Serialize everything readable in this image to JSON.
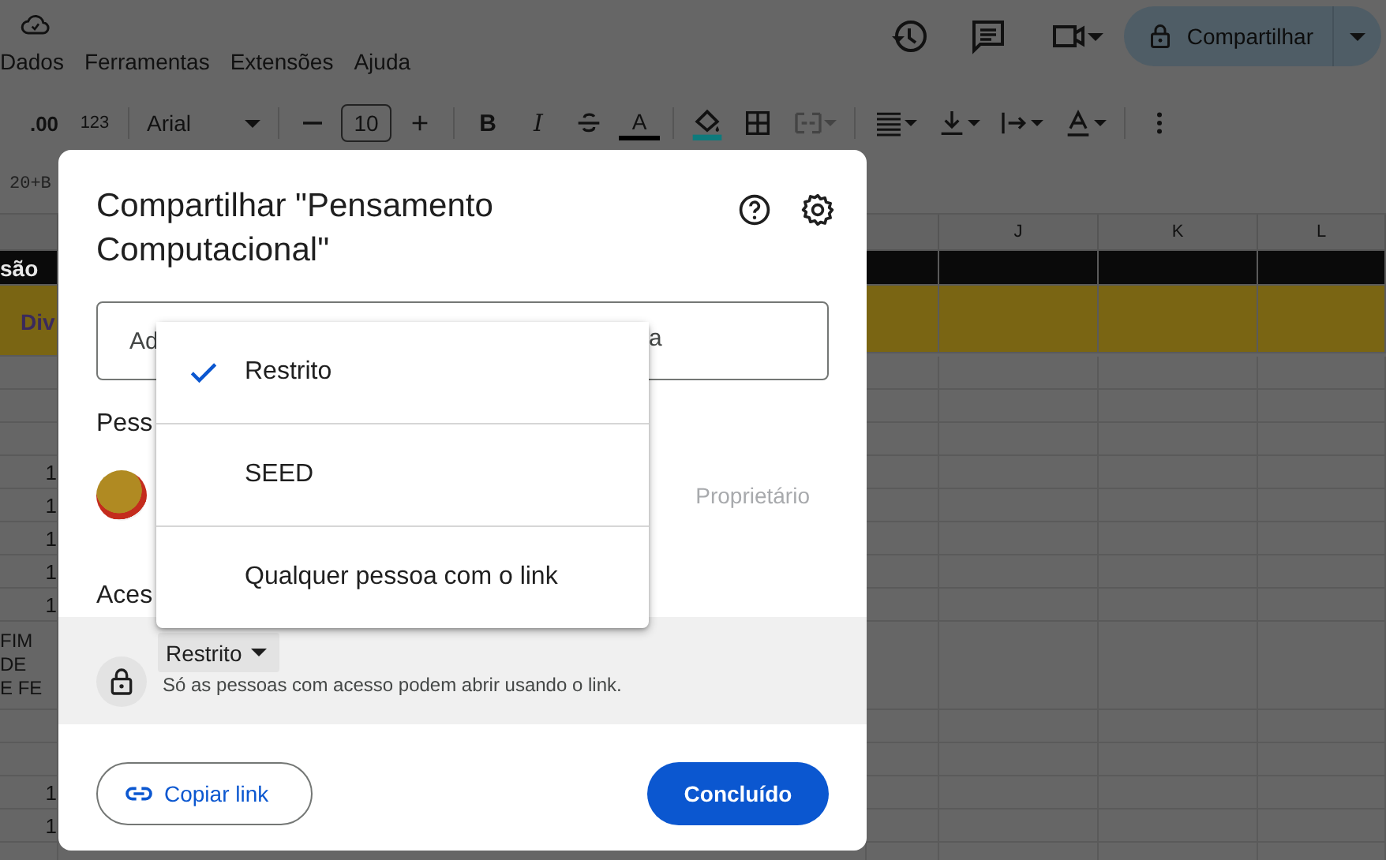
{
  "app": {
    "menu_bar": [
      {
        "label": "Dados"
      },
      {
        "label": "Ferramentas"
      },
      {
        "label": "Extensões"
      },
      {
        "label": "Ajuda"
      }
    ],
    "share_button": {
      "label": "Compartilhar"
    },
    "toolbar": {
      "decimal": ".00",
      "number_format": "123",
      "font": "Arial",
      "font_size": "10",
      "bold": "B",
      "italic": "I",
      "text_color": "A"
    },
    "formula_bar": {
      "formula": "20+B"
    },
    "sheet": {
      "columns": [
        "J",
        "K",
        "L"
      ],
      "rows": [
        {
          "kind": "header",
          "text": "são"
        },
        {
          "kind": "highlight",
          "text": "Div"
        },
        {
          "kind": "plain"
        },
        {
          "kind": "plain"
        },
        {
          "kind": "plain"
        },
        {
          "kind": "plain",
          "text": "1"
        },
        {
          "kind": "plain",
          "text": "1"
        },
        {
          "kind": "plain",
          "text": "1"
        },
        {
          "kind": "plain",
          "text": "1"
        },
        {
          "kind": "plain",
          "text": "1"
        },
        {
          "kind": "tall",
          "text": "FIM DE\nE FE"
        },
        {
          "kind": "plain"
        },
        {
          "kind": "plain"
        },
        {
          "kind": "plain",
          "text": "1"
        },
        {
          "kind": "plain",
          "text": "1"
        },
        {
          "kind": "plain"
        }
      ]
    }
  },
  "share_dialog": {
    "title": "Compartilhar \"Pensamento Computacional\"",
    "add_field": {
      "placeholder": "Ad",
      "placeholder_end": "a"
    },
    "people_heading": "Pess",
    "people": [
      {
        "role": "Proprietário"
      }
    ],
    "general_access": {
      "heading": "Aces",
      "dropdown": "Restrito",
      "description": "Só as pessoas com acesso podem abrir usando o link."
    },
    "buttons": {
      "copy_link": "Copiar link",
      "done": "Concluído"
    }
  },
  "access_menu": [
    {
      "label": "Restrito",
      "selected": true
    },
    {
      "label": "SEED",
      "selected": false
    },
    {
      "label": "Qualquer pessoa com o link",
      "selected": false
    }
  ]
}
